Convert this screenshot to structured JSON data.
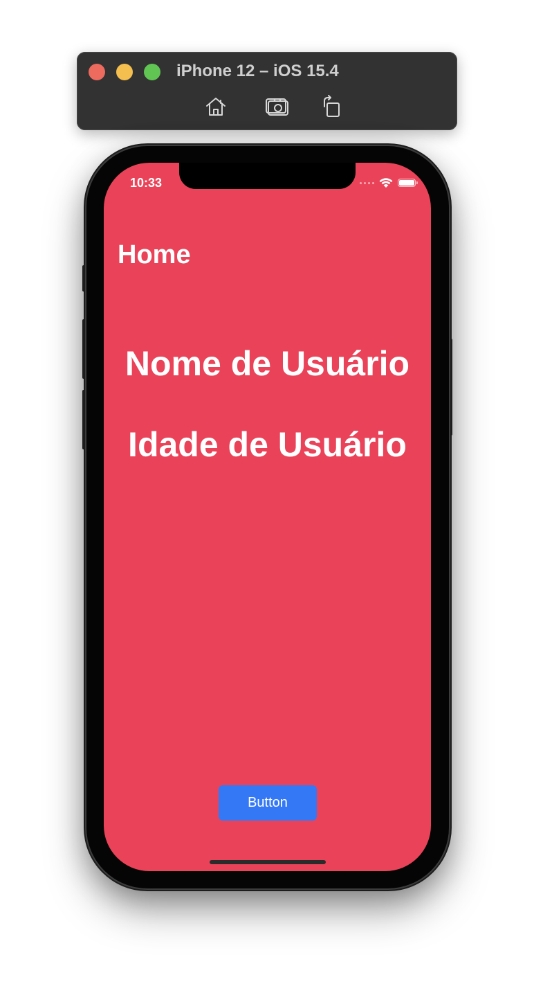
{
  "simulator": {
    "title": "iPhone 12 – iOS 15.4",
    "colors": {
      "bar": "#323232",
      "close": "#ec6a5e",
      "minimize": "#f4bf4f",
      "zoom": "#61c554"
    },
    "toolbar": [
      {
        "icon": "home-icon"
      },
      {
        "icon": "screenshot-icon"
      },
      {
        "icon": "rotate-icon"
      }
    ]
  },
  "status_bar": {
    "time": "10:33",
    "icons": [
      "cellular-dots-icon",
      "wifi-icon",
      "battery-icon"
    ]
  },
  "screen": {
    "background_color": "#ea4359",
    "nav_title": "Home",
    "user_name_label": "Nome de Usuário",
    "user_age_label": "Idade de Usuário",
    "button": {
      "label": "Button",
      "color": "#3478f6"
    }
  }
}
